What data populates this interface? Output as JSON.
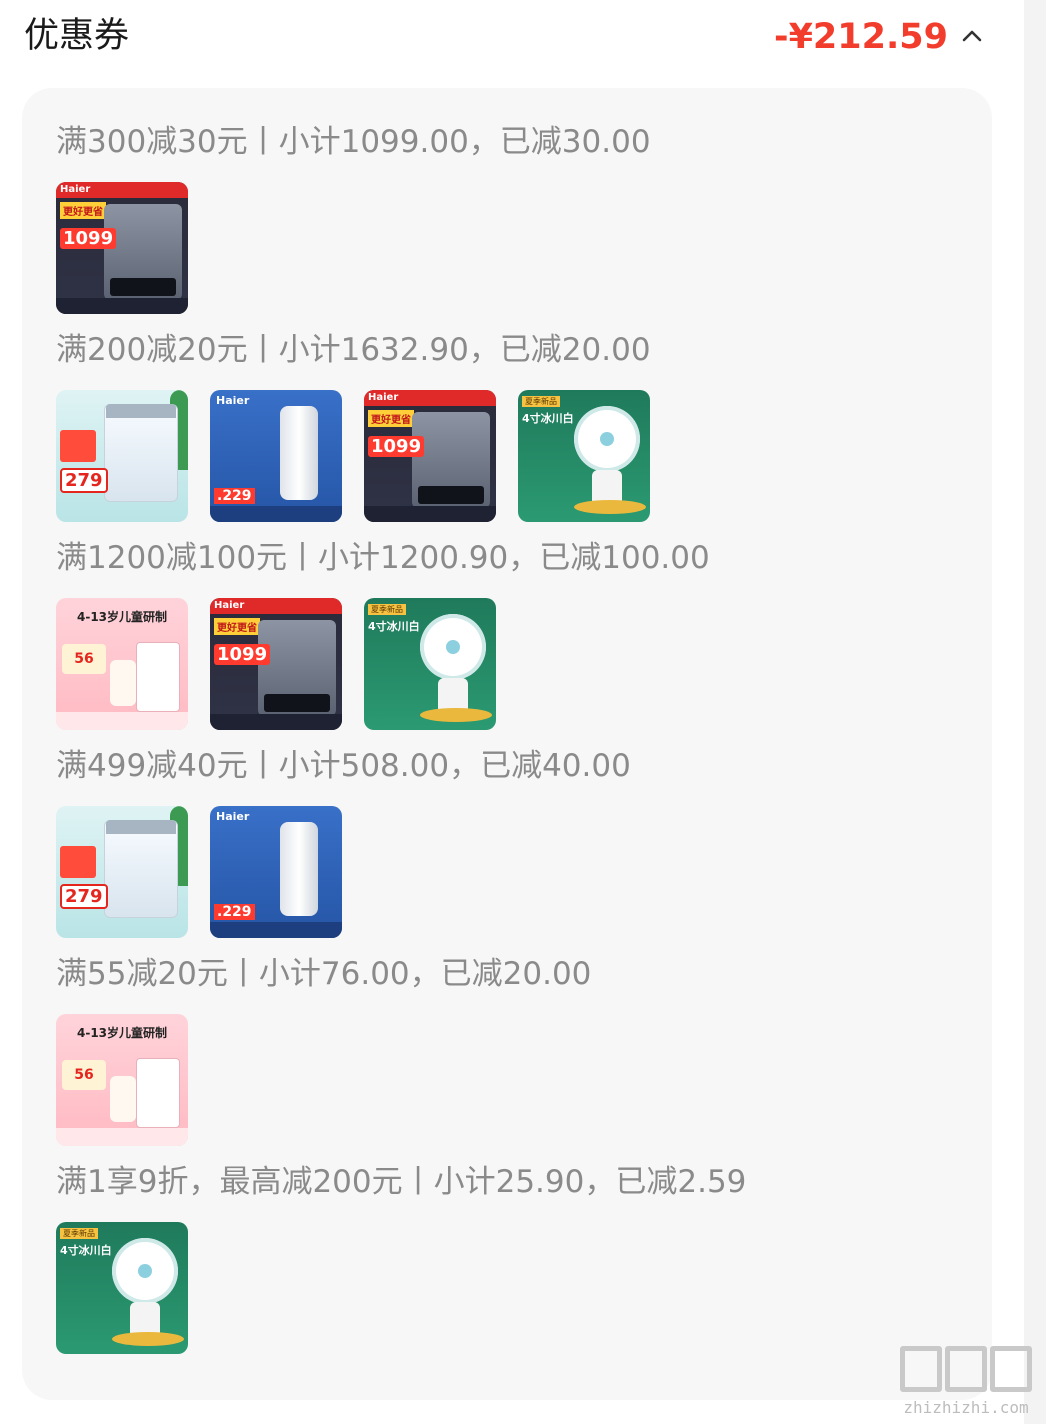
{
  "header": {
    "title": "优惠券",
    "total_discount": "-¥212.59",
    "collapse_icon": "chevron-up-icon"
  },
  "groups": [
    {
      "rule": "满300减30元丨小计1099.00，已减30.00",
      "products": [
        "water-heater"
      ]
    },
    {
      "rule": "满200减20元丨小计1632.90，已减20.00",
      "products": [
        "washing-machine",
        "water-filter",
        "water-heater",
        "clip-fan"
      ]
    },
    {
      "rule": "满1200减100元丨小计1200.90，已减100.00",
      "products": [
        "vitamin-c",
        "water-heater",
        "clip-fan"
      ]
    },
    {
      "rule": "满499减40元丨小计508.00，已减40.00",
      "products": [
        "washing-machine",
        "water-filter"
      ]
    },
    {
      "rule": "满55减20元丨小计76.00，已减20.00",
      "products": [
        "vitamin-c"
      ]
    },
    {
      "rule": "满1享9折，最高减200元丨小计25.90，已减2.59",
      "products": [
        "clip-fan"
      ]
    }
  ],
  "product_art": {
    "water-heater": {
      "brand": "Haier",
      "price": "1099",
      "badge": "更好更省"
    },
    "washing-machine": {
      "price": "279"
    },
    "water-filter": {
      "brand": "Haier",
      "price": ".229"
    },
    "clip-fan": {
      "label": "夏季新品",
      "title": "4寸冰川白"
    },
    "vitamin-c": {
      "headline": "4-13岁儿童研制",
      "price": "56"
    }
  },
  "watermark": {
    "text": "zhizhizhi.com"
  },
  "colors": {
    "accent": "#f23d2d",
    "card_bg": "#f7f7f7",
    "rule_text": "#8a8a8a"
  }
}
